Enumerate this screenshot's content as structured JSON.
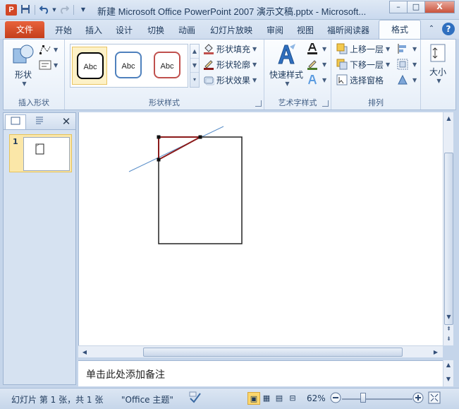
{
  "titlebar": {
    "app_icon_letter": "P",
    "title": "新建 Microsoft Office PowerPoint 2007 演示文稿.pptx - Microsoft...",
    "minimize": "–",
    "maximize": "□",
    "close": "X"
  },
  "qat": {
    "save_icon": "save-icon",
    "undo_icon": "undo-icon",
    "redo_icon": "redo-icon"
  },
  "tabs": {
    "file": "文件",
    "items": [
      "开始",
      "插入",
      "设计",
      "切换",
      "动画",
      "幻灯片放映",
      "审阅",
      "视图",
      "福昕阅读器",
      "格式"
    ],
    "active": "格式"
  },
  "ribbon": {
    "insert_shapes": {
      "shapes_label": "形状",
      "group_label": "插入形状"
    },
    "shape_styles": {
      "swatches": [
        {
          "label": "Abc",
          "border": "#000000"
        },
        {
          "label": "Abc",
          "border": "#4f81bd"
        },
        {
          "label": "Abc",
          "border": "#c0504d"
        }
      ],
      "fill": "形状填充",
      "outline": "形状轮廓",
      "effects": "形状效果",
      "group_label": "形状样式"
    },
    "wordart": {
      "quick_styles": "快速样式",
      "group_label": "艺术字样式"
    },
    "arrange": {
      "bring_forward": "上移一层",
      "send_backward": "下移一层",
      "selection_pane": "选择窗格",
      "group_label": "排列"
    },
    "size": {
      "label": "大小"
    }
  },
  "leftpane": {
    "slide_number": "1"
  },
  "notes": {
    "placeholder": "单击此处添加备注"
  },
  "status": {
    "slide_info": "幻灯片 第 1 张，共 1 张",
    "theme": "\"Office 主题\"",
    "zoom": "62%"
  },
  "colors": {
    "selection_edge": "#8b1a1a",
    "guide_line": "#5b8fc9",
    "file_tab": "#d24726"
  }
}
